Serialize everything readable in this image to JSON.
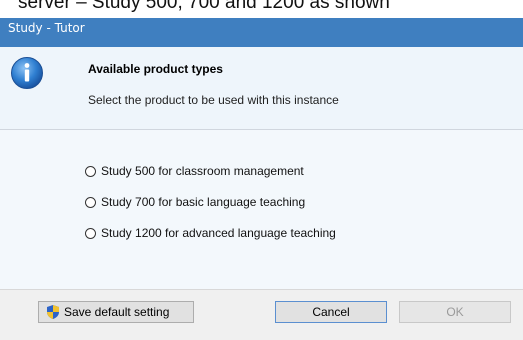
{
  "caption": "server – Study 500, 700 and 1200 as shown",
  "window": {
    "title": "Study - Tutor"
  },
  "header": {
    "icon": "info-icon",
    "title": "Available product types",
    "subtitle": "Select the product to be used with this instance"
  },
  "options": [
    {
      "label": "Study 500 for classroom management",
      "selected": false
    },
    {
      "label": "Study 700 for basic language teaching",
      "selected": false
    },
    {
      "label": "Study 1200 for advanced language teaching",
      "selected": false
    }
  ],
  "footer": {
    "save_default_label": "Save default setting",
    "save_icon": "shield-icon",
    "cancel_label": "Cancel",
    "ok_label": "OK",
    "ok_enabled": false
  },
  "colors": {
    "titlebar": "#3f7fc0",
    "header_bg": "#eef5fb",
    "body_bg": "#f3f8fc"
  }
}
